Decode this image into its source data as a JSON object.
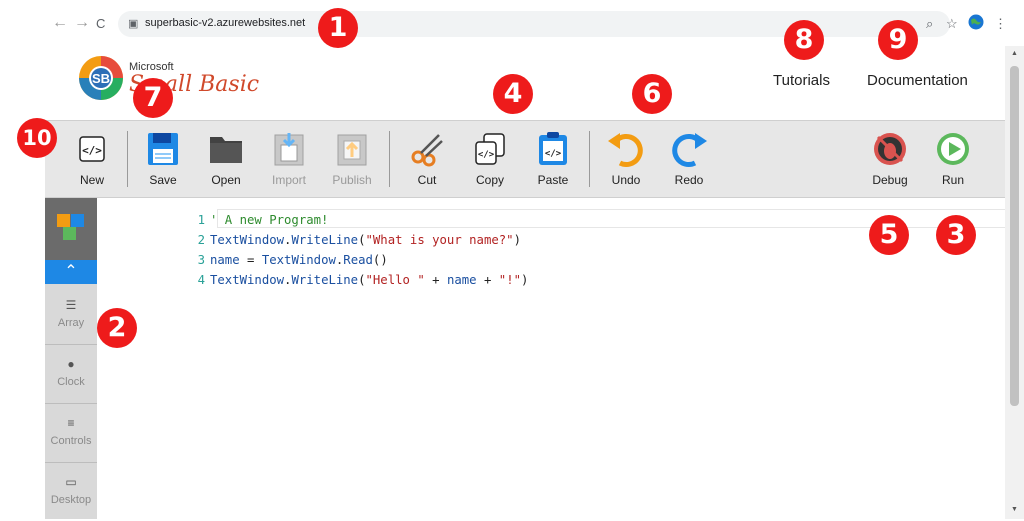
{
  "browser": {
    "url": "superbasic-v2.azurewebsites.net",
    "back_icon": "←",
    "forward_icon": "→",
    "reload_icon": "C",
    "lock_icon": "🔒"
  },
  "header": {
    "logo_microsoft": "Microsoft",
    "logo_product": "Small Basic",
    "tutorials": "Tutorials",
    "documentation": "Documentation"
  },
  "toolbar": {
    "new": "New",
    "save": "Save",
    "open": "Open",
    "import": "Import",
    "publish": "Publish",
    "cut": "Cut",
    "copy": "Copy",
    "paste": "Paste",
    "undo": "Undo",
    "redo": "Redo",
    "debug": "Debug",
    "run": "Run"
  },
  "sidebar": {
    "items": [
      {
        "label": "Array",
        "icon": "list-icon"
      },
      {
        "label": "Clock",
        "icon": "clock-icon"
      },
      {
        "label": "Controls",
        "icon": "sliders-icon"
      },
      {
        "label": "Desktop",
        "icon": "monitor-icon"
      }
    ]
  },
  "editor": {
    "lines": [
      {
        "n": "1",
        "parts": [
          {
            "t": "' A new Program!",
            "c": "com"
          }
        ]
      },
      {
        "n": "2",
        "parts": [
          {
            "t": "TextWindow",
            "c": "obj"
          },
          {
            "t": ".",
            "c": "pl"
          },
          {
            "t": "WriteLine",
            "c": "obj"
          },
          {
            "t": "(",
            "c": "pl"
          },
          {
            "t": "\"What is your name?\"",
            "c": "str"
          },
          {
            "t": ")",
            "c": "pl"
          }
        ]
      },
      {
        "n": "3",
        "parts": [
          {
            "t": "name",
            "c": "var"
          },
          {
            "t": " = ",
            "c": "pl"
          },
          {
            "t": "TextWindow",
            "c": "obj"
          },
          {
            "t": ".",
            "c": "pl"
          },
          {
            "t": "Read",
            "c": "obj"
          },
          {
            "t": "()",
            "c": "pl"
          }
        ]
      },
      {
        "n": "4",
        "parts": [
          {
            "t": "TextWindow",
            "c": "obj"
          },
          {
            "t": ".",
            "c": "pl"
          },
          {
            "t": "WriteLine",
            "c": "obj"
          },
          {
            "t": "(",
            "c": "pl"
          },
          {
            "t": "\"Hello \"",
            "c": "str"
          },
          {
            "t": " + ",
            "c": "pl"
          },
          {
            "t": "name",
            "c": "var"
          },
          {
            "t": " + ",
            "c": "pl"
          },
          {
            "t": "\"!\"",
            "c": "str"
          },
          {
            "t": ")",
            "c": "pl"
          }
        ]
      }
    ]
  },
  "annotations": [
    "1",
    "2",
    "3",
    "4",
    "5",
    "6",
    "7",
    "8",
    "9",
    "10"
  ],
  "colors": {
    "badge": "#ee1b1b",
    "accent": "#1e88e5",
    "undo": "#f39c12",
    "run": "#5cb85c",
    "debug": "#d9534f"
  }
}
